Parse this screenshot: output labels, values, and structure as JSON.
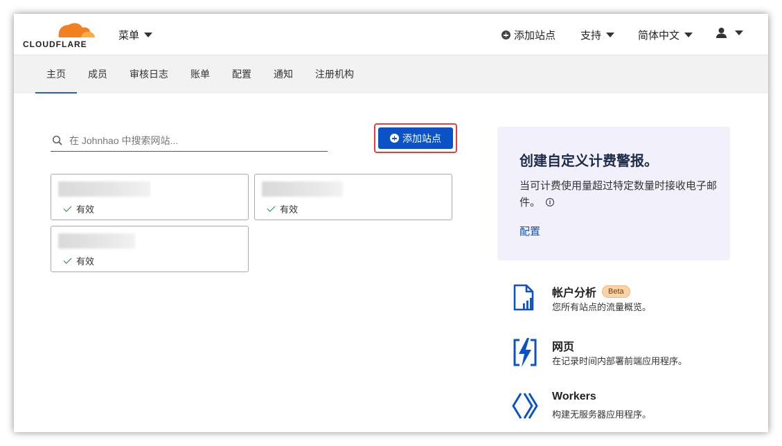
{
  "header": {
    "logo_text": "CLOUDFLARE",
    "menu_label": "菜单",
    "add_site_label": "添加站点",
    "support_label": "支持",
    "language_label": "简体中文",
    "user_icon": "user-icon"
  },
  "nav": {
    "tabs": [
      {
        "label": "主页",
        "active": true
      },
      {
        "label": "成员"
      },
      {
        "label": "审核日志"
      },
      {
        "label": "账单"
      },
      {
        "label": "配置"
      },
      {
        "label": "通知"
      },
      {
        "label": "注册机构"
      }
    ]
  },
  "search": {
    "placeholder": "在 Johnhao 中搜索网站..."
  },
  "add_site_button": "添加站点",
  "sites": [
    {
      "status": "有效"
    },
    {
      "status": "有效"
    },
    {
      "status": "有效"
    }
  ],
  "promo": {
    "title": "创建自定义计费警报。",
    "description": "当可计费使用量超过特定数量时接收电子邮件。",
    "link": "配置"
  },
  "features": [
    {
      "title": "帐户分析",
      "badge": "Beta",
      "description": "您所有站点的流量概览。",
      "icon": "analytics-icon"
    },
    {
      "title": "网页",
      "description": "在记录时间内部署前端应用程序。",
      "icon": "pages-icon"
    },
    {
      "title": "Workers",
      "description": "构建无服务器应用程序。",
      "icon": "workers-icon"
    }
  ],
  "colors": {
    "brand_orange": "#f38020",
    "primary_blue": "#0b52c6",
    "highlight_red": "#e0403d",
    "promo_bg": "#f1f0fb"
  }
}
